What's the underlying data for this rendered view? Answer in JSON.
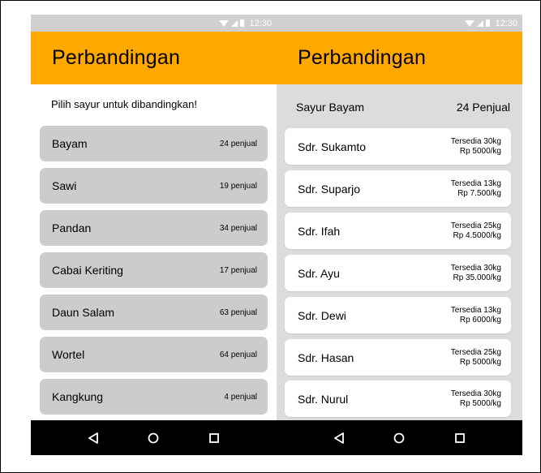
{
  "status": {
    "time": "12:30"
  },
  "left": {
    "title": "Perbandingan",
    "prompt": "Pilih sayur untuk dibandingkan!",
    "vegetables": [
      {
        "name": "Bayam",
        "count": "24 penjual"
      },
      {
        "name": "Sawi",
        "count": "19 penjual"
      },
      {
        "name": "Pandan",
        "count": "34 penjual"
      },
      {
        "name": "Cabai Keriting",
        "count": "17 penjual"
      },
      {
        "name": "Daun Salam",
        "count": "63 penjual"
      },
      {
        "name": "Wortel",
        "count": "64 penjual"
      },
      {
        "name": "Kangkung",
        "count": "4 penjual"
      }
    ]
  },
  "right": {
    "title": "Perbandingan",
    "selected_vegetable": "Sayur Bayam",
    "seller_total": "24 Penjual",
    "sellers": [
      {
        "name": "Sdr. Sukamto",
        "stock": "Tersedia 30kg",
        "price": "Rp 5000/kg"
      },
      {
        "name": "Sdr. Suparjo",
        "stock": "Tersedia 13kg",
        "price": "Rp 7.500/kg"
      },
      {
        "name": "Sdr. Ifah",
        "stock": "Tersedia 25kg",
        "price": "Rp 4.5000/kg"
      },
      {
        "name": "Sdr. Ayu",
        "stock": "Tersedia 30kg",
        "price": "Rp 35.000/kg"
      },
      {
        "name": "Sdr. Dewi",
        "stock": "Tersedia 13kg",
        "price": "Rp 6000/kg"
      },
      {
        "name": "Sdr. Hasan",
        "stock": "Tersedia 25kg",
        "price": "Rp 5000/kg"
      },
      {
        "name": "Sdr. Nurul",
        "stock": "Tersedia 30kg",
        "price": "Rp 5000/kg"
      }
    ]
  },
  "colors": {
    "appbar": "#ffa800",
    "statusbar": "#d0d0d0",
    "list_item": "#cccccc",
    "detail_bg": "#dcdcdc",
    "navbar": "#000000"
  },
  "icons": {
    "nav": [
      "back-triangle-icon",
      "home-circle-icon",
      "recents-square-icon"
    ]
  }
}
